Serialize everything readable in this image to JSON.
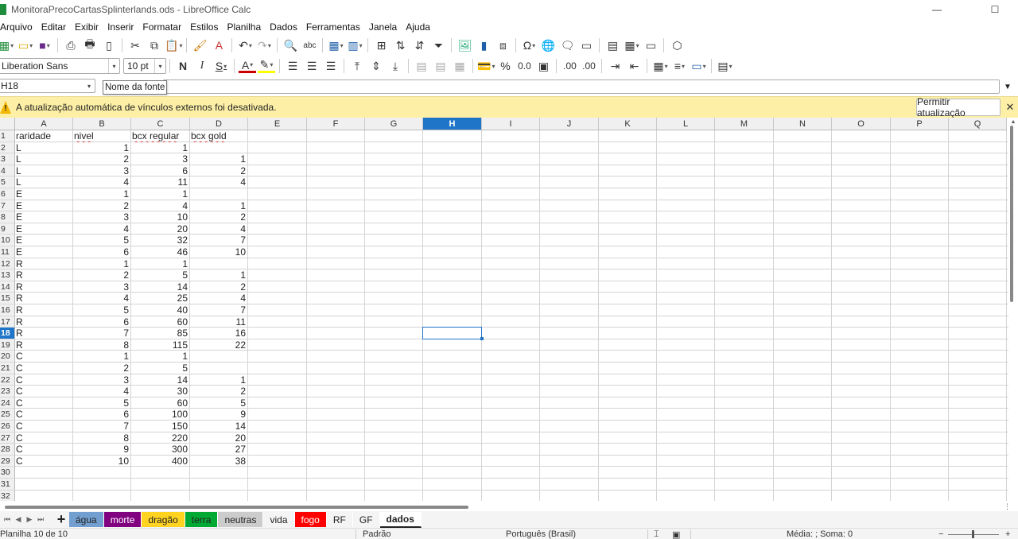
{
  "window": {
    "title": "MonitoraPrecoCartasSplinterlands.ods - LibreOffice Calc",
    "minimize_glyph": "—",
    "maximize_glyph": "☐"
  },
  "menu": [
    "Arquivo",
    "Editar",
    "Exibir",
    "Inserir",
    "Formatar",
    "Estilos",
    "Planilha",
    "Dados",
    "Ferramentas",
    "Janela",
    "Ajuda"
  ],
  "format_toolbar": {
    "font_name": "Liberation Sans",
    "font_size": "10 pt",
    "bold": "N",
    "italic": "I",
    "shadow": "S",
    "percent": "%",
    "decimal": "0.0",
    "add_decimal": ".00",
    "del_decimal": ".00"
  },
  "formula_bar": {
    "cell_ref": "H18",
    "tooltip": "Nome da fonte",
    "formula": ""
  },
  "infobar": {
    "message": "A atualização automática de vínculos externos foi desativada.",
    "button_label": "Permitir atualização",
    "close_glyph": "✕",
    "warn_glyph": "!"
  },
  "grid": {
    "columns": [
      "A",
      "B",
      "C",
      "D",
      "E",
      "F",
      "G",
      "H",
      "I",
      "J",
      "K",
      "L",
      "M",
      "N",
      "O",
      "P",
      "Q"
    ],
    "selected_column": "H",
    "selected_row": "18",
    "row_numbers": [
      "1",
      "2",
      "3",
      "4",
      "5",
      "6",
      "7",
      "8",
      "9",
      "10",
      "11",
      "12",
      "13",
      "14",
      "15",
      "16",
      "17",
      "18",
      "19",
      "20",
      "21",
      "22",
      "23",
      "24",
      "25",
      "26",
      "27",
      "28",
      "29",
      "30",
      "31",
      "32"
    ],
    "headers": [
      "raridade",
      "nivel",
      "bcx regular",
      "bcx gold"
    ],
    "rows": [
      {
        "raridade": "L",
        "nivel": "1",
        "bcx_regular": "1",
        "bcx_gold": ""
      },
      {
        "raridade": "L",
        "nivel": "2",
        "bcx_regular": "3",
        "bcx_gold": "1"
      },
      {
        "raridade": "L",
        "nivel": "3",
        "bcx_regular": "6",
        "bcx_gold": "2"
      },
      {
        "raridade": "L",
        "nivel": "4",
        "bcx_regular": "11",
        "bcx_gold": "4"
      },
      {
        "raridade": "E",
        "nivel": "1",
        "bcx_regular": "1",
        "bcx_gold": ""
      },
      {
        "raridade": "E",
        "nivel": "2",
        "bcx_regular": "4",
        "bcx_gold": "1"
      },
      {
        "raridade": "E",
        "nivel": "3",
        "bcx_regular": "10",
        "bcx_gold": "2"
      },
      {
        "raridade": "E",
        "nivel": "4",
        "bcx_regular": "20",
        "bcx_gold": "4"
      },
      {
        "raridade": "E",
        "nivel": "5",
        "bcx_regular": "32",
        "bcx_gold": "7"
      },
      {
        "raridade": "E",
        "nivel": "6",
        "bcx_regular": "46",
        "bcx_gold": "10"
      },
      {
        "raridade": "R",
        "nivel": "1",
        "bcx_regular": "1",
        "bcx_gold": ""
      },
      {
        "raridade": "R",
        "nivel": "2",
        "bcx_regular": "5",
        "bcx_gold": "1"
      },
      {
        "raridade": "R",
        "nivel": "3",
        "bcx_regular": "14",
        "bcx_gold": "2"
      },
      {
        "raridade": "R",
        "nivel": "4",
        "bcx_regular": "25",
        "bcx_gold": "4"
      },
      {
        "raridade": "R",
        "nivel": "5",
        "bcx_regular": "40",
        "bcx_gold": "7"
      },
      {
        "raridade": "R",
        "nivel": "6",
        "bcx_regular": "60",
        "bcx_gold": "11"
      },
      {
        "raridade": "R",
        "nivel": "7",
        "bcx_regular": "85",
        "bcx_gold": "16"
      },
      {
        "raridade": "R",
        "nivel": "8",
        "bcx_regular": "115",
        "bcx_gold": "22"
      },
      {
        "raridade": "C",
        "nivel": "1",
        "bcx_regular": "1",
        "bcx_gold": ""
      },
      {
        "raridade": "C",
        "nivel": "2",
        "bcx_regular": "5",
        "bcx_gold": ""
      },
      {
        "raridade": "C",
        "nivel": "3",
        "bcx_regular": "14",
        "bcx_gold": "1"
      },
      {
        "raridade": "C",
        "nivel": "4",
        "bcx_regular": "30",
        "bcx_gold": "2"
      },
      {
        "raridade": "C",
        "nivel": "5",
        "bcx_regular": "60",
        "bcx_gold": "5"
      },
      {
        "raridade": "C",
        "nivel": "6",
        "bcx_regular": "100",
        "bcx_gold": "9"
      },
      {
        "raridade": "C",
        "nivel": "7",
        "bcx_regular": "150",
        "bcx_gold": "14"
      },
      {
        "raridade": "C",
        "nivel": "8",
        "bcx_regular": "220",
        "bcx_gold": "20"
      },
      {
        "raridade": "C",
        "nivel": "9",
        "bcx_regular": "300",
        "bcx_gold": "27"
      },
      {
        "raridade": "C",
        "nivel": "10",
        "bcx_regular": "400",
        "bcx_gold": "38"
      }
    ]
  },
  "sheet_tabs": [
    {
      "label": "água",
      "color": "#729fcf"
    },
    {
      "label": "morte",
      "color": "#800080"
    },
    {
      "label": "dragão",
      "color": "#ffd320"
    },
    {
      "label": "terra",
      "color": "#00a933"
    },
    {
      "label": "neutras",
      "color": "#cccccc"
    },
    {
      "label": "vida",
      "color": ""
    },
    {
      "label": "fogo",
      "color": "#ff0000"
    },
    {
      "label": "RF",
      "color": ""
    },
    {
      "label": "GF",
      "color": ""
    },
    {
      "label": "dados",
      "color": "",
      "active": true
    }
  ],
  "status": {
    "sheet": "Planilha 10 de 10",
    "style": "Padrão",
    "language": "Português (Brasil)",
    "stats": "Média: ; Soma: 0",
    "zoom_minus": "−",
    "zoom_plus": "+"
  }
}
